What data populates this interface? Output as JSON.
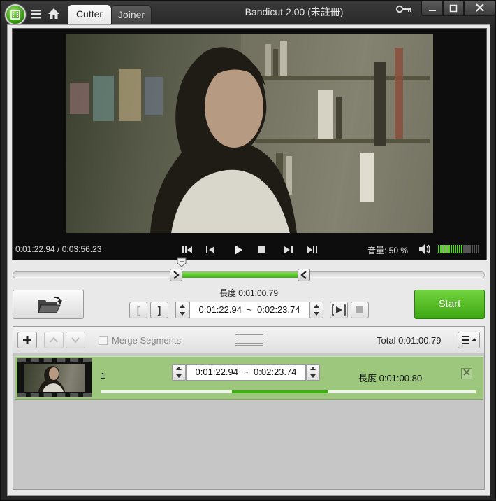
{
  "window": {
    "title": "Bandicut 2.00 (未註冊)",
    "tabs": [
      {
        "label": "Cutter",
        "active": true
      },
      {
        "label": "Joiner",
        "active": false
      }
    ],
    "controls": {
      "minimize": "minimize-icon",
      "maximize": "maximize-icon",
      "close": "close-icon"
    }
  },
  "player": {
    "time_readout": "0:01:22.94 / 0:03:56.23",
    "volume_label": "音量: 50 %",
    "volume_level": 0.5,
    "buttons": [
      "prev-keyframe-icon",
      "prev-frame-icon",
      "play-icon",
      "stop-icon",
      "next-frame-icon",
      "next-keyframe-icon"
    ]
  },
  "timeline": {
    "duration": "0:03:56.23",
    "position": "0:01:22.94",
    "selection_start": "0:01:22.94",
    "selection_end": "0:02:23.74"
  },
  "cutter": {
    "length_label": "長度 0:01:00.79",
    "start_time": "0:01:22.94",
    "end_time": "0:02:23.74",
    "separator": "~",
    "set_start_label": "[",
    "set_end_label": "]",
    "start_button": "Start"
  },
  "segments_toolbar": {
    "merge_label": "Merge Segments",
    "merge_checked": false,
    "total_label": "Total 0:01:00.79"
  },
  "segments": [
    {
      "index": "1",
      "start_time": "0:01:22.94",
      "end_time": "0:02:23.74",
      "length_label": "長度 0:01:00.80",
      "range_start_fraction": 0.351,
      "range_end_fraction": 0.608
    }
  ],
  "colors": {
    "accent_green": "#3fae14",
    "segment_row": "#9cc77c"
  }
}
